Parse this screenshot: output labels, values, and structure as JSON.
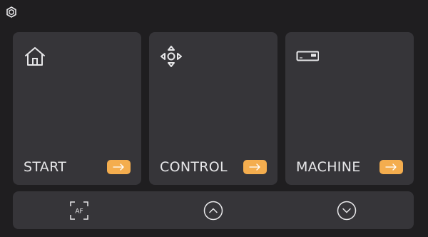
{
  "colors": {
    "background": "#1f1e20",
    "card": "#363539",
    "accent": "#f4ad4e",
    "text": "#e7e7e9"
  },
  "header": {
    "logo_icon": "hex-logo-icon"
  },
  "cards": [
    {
      "label": "START",
      "icon": "home-icon"
    },
    {
      "label": "CONTROL",
      "icon": "move-arrows-icon"
    },
    {
      "label": "MACHINE",
      "icon": "machine-icon"
    }
  ],
  "bottom_bar": {
    "autofocus_label": "AF",
    "buttons": [
      "autofocus-icon",
      "chevron-up-circle-icon",
      "chevron-down-circle-icon"
    ]
  }
}
